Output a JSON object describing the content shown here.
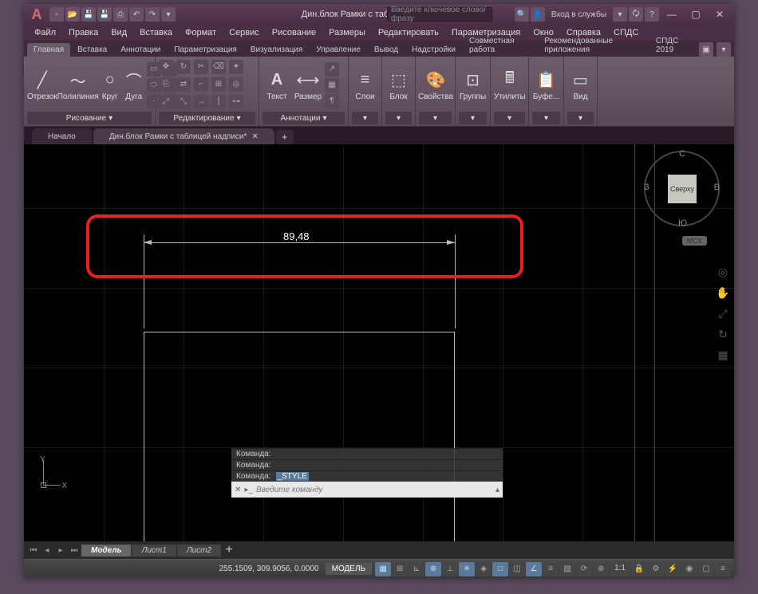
{
  "title": "Дин.блок Рамки с таблицей надписи...",
  "search_placeholder": "Введите ключевое слово/фразу",
  "sign_in": "Вход в службы",
  "menu": [
    "Файл",
    "Правка",
    "Вид",
    "Вставка",
    "Формат",
    "Сервис",
    "Рисование",
    "Размеры",
    "Редактировать",
    "Параметризация",
    "Окно",
    "Справка",
    "СПДС"
  ],
  "ribbon_tabs": [
    "Главная",
    "Вставка",
    "Аннотации",
    "Параметризация",
    "Визуализация",
    "Управление",
    "Вывод",
    "Надстройки",
    "Совместная работа",
    "Рекомендованные приложения",
    "СПДС 2019"
  ],
  "panels": {
    "draw": {
      "title": "Рисование",
      "btns": {
        "line": "Отрезок",
        "polyline": "Полилиния",
        "circle": "Круг",
        "arc": "Дуга"
      }
    },
    "edit": {
      "title": "Редактирование"
    },
    "annot": {
      "title": "Аннотации",
      "btns": {
        "text": "Текст",
        "dim": "Размер"
      }
    },
    "layers": {
      "title": "Слои"
    },
    "block": {
      "title": "Блок"
    },
    "props": {
      "title": "Свойства"
    },
    "groups": {
      "title": "Группы"
    },
    "utils": {
      "title": "Утилиты"
    },
    "clip": {
      "title": "Буфе..."
    },
    "view": {
      "title": "Вид"
    }
  },
  "doc_tabs": {
    "start": "Начало",
    "file": "Дин.блок Рамки с таблицей надписи*"
  },
  "dimension_value": "89,48",
  "ucs": {
    "x": "X",
    "y": "Y"
  },
  "viewcube": {
    "top": "Сверху",
    "n": "С",
    "s": "Ю",
    "e": "В",
    "w": "З"
  },
  "mck": "МСК",
  "cmd_history": [
    {
      "prompt": "Команда:",
      "val": ""
    },
    {
      "prompt": "Команда:",
      "val": ""
    },
    {
      "prompt": "Команда:",
      "val": "_STYLE"
    }
  ],
  "cmd_placeholder": "Введите команду",
  "layout_tabs": [
    "Модель",
    "Лист1",
    "Лист2"
  ],
  "status": {
    "coords": "255.1509, 309.9056, 0.0000",
    "model": "МОДЕЛЬ",
    "scale": "1:1"
  }
}
